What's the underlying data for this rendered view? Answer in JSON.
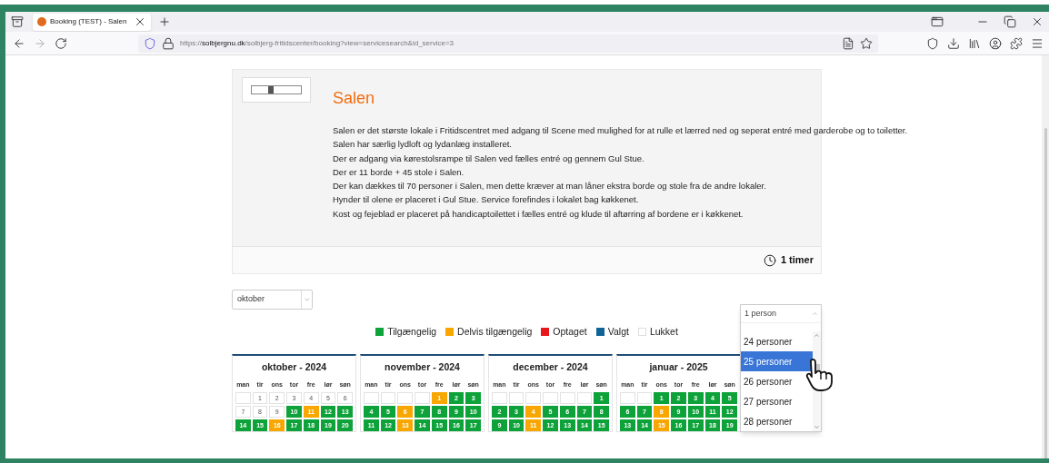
{
  "browser": {
    "tab_title": "Booking (TEST) - Salen",
    "url_scheme": "https://",
    "url_domain": "solbjergnu.dk",
    "url_path": "/solbjerg-fritidscenter/booking?view=servicesearch&id_service=3"
  },
  "service": {
    "title": "Salen",
    "description": [
      "Salen er det største lokale i Fritidscentret med adgang til Scene med mulighed for at rulle et lærred ned og seperat entré med garderobe og to toiletter.",
      "Salen har særlig lydloft og lydanlæg installeret.",
      "Der er adgang via kørestolsrampe til Salen ved fælles entré og gennem Gul Stue.",
      "Der er 11 borde + 45 stole i Salen.",
      "Der kan dækkes til 70 personer i Salen, men dette kræver at man låner ekstra borde og stole fra de andre lokaler.",
      "Hynder til olene er placeret i Gul Stue. Service forefindes i lokalet bag køkkenet.",
      "Kost og fejeblad er placeret på handicaptoilettet i fælles entré og klude til aftørring af bordene er i køkkenet."
    ],
    "duration": "1 timer"
  },
  "month_select": {
    "value": "oktober"
  },
  "persons_select": {
    "value": "1 person",
    "options": [
      {
        "label": "24 personer",
        "selected": false
      },
      {
        "label": "25 personer",
        "selected": true
      },
      {
        "label": "26 personer",
        "selected": false
      },
      {
        "label": "27 personer",
        "selected": false
      },
      {
        "label": "28 personer",
        "selected": false
      }
    ]
  },
  "legend": [
    {
      "label": "Tilgængelig",
      "color": "#0ea33a"
    },
    {
      "label": "Delvis tilgængelig",
      "color": "#f8a700"
    },
    {
      "label": "Optaget",
      "color": "#e8171b"
    },
    {
      "label": "Valgt",
      "color": "#0f6397"
    },
    {
      "label": "Lukket",
      "color": "#ffffff"
    }
  ],
  "calendars": [
    {
      "title": "oktober - 2024",
      "weekdays": [
        "man",
        "tir",
        "ons",
        "tor",
        "fre",
        "lør",
        "søn"
      ],
      "days": [
        {
          "kind": "empty"
        },
        {
          "day": "1",
          "kind": "closed"
        },
        {
          "day": "2",
          "kind": "closed"
        },
        {
          "day": "3",
          "kind": "closed"
        },
        {
          "day": "4",
          "kind": "closed"
        },
        {
          "day": "5",
          "kind": "closed"
        },
        {
          "day": "6",
          "kind": "closed"
        },
        {
          "day": "7",
          "kind": "closed"
        },
        {
          "day": "8",
          "kind": "closed"
        },
        {
          "day": "9",
          "kind": "closed"
        },
        {
          "day": "10",
          "kind": "available"
        },
        {
          "day": "11",
          "kind": "partial"
        },
        {
          "day": "12",
          "kind": "available"
        },
        {
          "day": "13",
          "kind": "available"
        },
        {
          "day": "14",
          "kind": "available"
        },
        {
          "day": "15",
          "kind": "available"
        },
        {
          "day": "16",
          "kind": "partial"
        },
        {
          "day": "17",
          "kind": "available"
        },
        {
          "day": "18",
          "kind": "available"
        },
        {
          "day": "19",
          "kind": "available"
        },
        {
          "day": "20",
          "kind": "available"
        }
      ]
    },
    {
      "title": "november - 2024",
      "weekdays": [
        "man",
        "tir",
        "ons",
        "tor",
        "fre",
        "lør",
        "søn"
      ],
      "days": [
        {
          "kind": "empty"
        },
        {
          "kind": "empty"
        },
        {
          "kind": "empty"
        },
        {
          "kind": "empty"
        },
        {
          "day": "1",
          "kind": "partial"
        },
        {
          "day": "2",
          "kind": "available"
        },
        {
          "day": "3",
          "kind": "available"
        },
        {
          "day": "4",
          "kind": "available"
        },
        {
          "day": "5",
          "kind": "available"
        },
        {
          "day": "6",
          "kind": "partial"
        },
        {
          "day": "7",
          "kind": "available"
        },
        {
          "day": "8",
          "kind": "available"
        },
        {
          "day": "9",
          "kind": "available"
        },
        {
          "day": "10",
          "kind": "available"
        },
        {
          "day": "11",
          "kind": "available"
        },
        {
          "day": "12",
          "kind": "available"
        },
        {
          "day": "13",
          "kind": "partial"
        },
        {
          "day": "14",
          "kind": "available"
        },
        {
          "day": "15",
          "kind": "available"
        },
        {
          "day": "16",
          "kind": "available"
        },
        {
          "day": "17",
          "kind": "available"
        }
      ]
    },
    {
      "title": "december - 2024",
      "weekdays": [
        "man",
        "tir",
        "ons",
        "tor",
        "fre",
        "lør",
        "søn"
      ],
      "days": [
        {
          "kind": "empty"
        },
        {
          "kind": "empty"
        },
        {
          "kind": "empty"
        },
        {
          "kind": "empty"
        },
        {
          "kind": "empty"
        },
        {
          "kind": "empty"
        },
        {
          "day": "1",
          "kind": "available"
        },
        {
          "day": "2",
          "kind": "available"
        },
        {
          "day": "3",
          "kind": "available"
        },
        {
          "day": "4",
          "kind": "partial"
        },
        {
          "day": "5",
          "kind": "available"
        },
        {
          "day": "6",
          "kind": "available"
        },
        {
          "day": "7",
          "kind": "available"
        },
        {
          "day": "8",
          "kind": "available"
        },
        {
          "day": "9",
          "kind": "available"
        },
        {
          "day": "10",
          "kind": "available"
        },
        {
          "day": "11",
          "kind": "partial"
        },
        {
          "day": "12",
          "kind": "available"
        },
        {
          "day": "13",
          "kind": "available"
        },
        {
          "day": "14",
          "kind": "available"
        },
        {
          "day": "15",
          "kind": "available"
        }
      ]
    },
    {
      "title": "januar - 2025",
      "weekdays": [
        "man",
        "tir",
        "ons",
        "tor",
        "fre",
        "lør",
        "søn"
      ],
      "days": [
        {
          "kind": "empty"
        },
        {
          "kind": "empty"
        },
        {
          "day": "1",
          "kind": "available"
        },
        {
          "day": "2",
          "kind": "available"
        },
        {
          "day": "3",
          "kind": "available"
        },
        {
          "day": "4",
          "kind": "available"
        },
        {
          "day": "5",
          "kind": "available"
        },
        {
          "day": "6",
          "kind": "available"
        },
        {
          "day": "7",
          "kind": "available"
        },
        {
          "day": "8",
          "kind": "partial"
        },
        {
          "day": "9",
          "kind": "available"
        },
        {
          "day": "10",
          "kind": "available"
        },
        {
          "day": "11",
          "kind": "available"
        },
        {
          "day": "12",
          "kind": "available"
        },
        {
          "day": "13",
          "kind": "available"
        },
        {
          "day": "14",
          "kind": "available"
        },
        {
          "day": "15",
          "kind": "partial"
        },
        {
          "day": "16",
          "kind": "available"
        },
        {
          "day": "17",
          "kind": "available"
        },
        {
          "day": "18",
          "kind": "available"
        },
        {
          "day": "19",
          "kind": "available"
        }
      ]
    }
  ]
}
